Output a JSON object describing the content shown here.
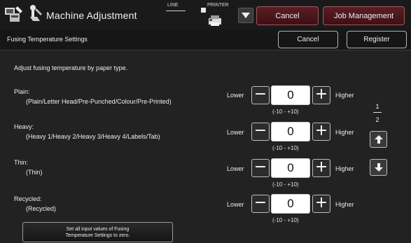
{
  "header": {
    "title": "Machine Adjustment",
    "line_label": "LINE",
    "printer_label": "PRINTER",
    "cancel_label": "Cancel",
    "job_management_label": "Job Management"
  },
  "subheader": {
    "title": "Fusing Temperature Settings",
    "cancel_label": "Cancel",
    "register_label": "Register"
  },
  "instruction": "Adjust fusing temperature by paper type.",
  "settings": [
    {
      "label": "Plain:",
      "description": "(Plain/Letter Head/Pre-Punched/Colour/Pre-Printed)",
      "value": "0",
      "lower_label": "Lower",
      "higher_label": "Higher",
      "range": "(-10 - +10)"
    },
    {
      "label": "Heavy:",
      "description": "(Heavy 1/Heavy 2/Heavy 3/Heavy 4/Labels/Tab)",
      "value": "0",
      "lower_label": "Lower",
      "higher_label": "Higher",
      "range": "(-10 - +10)"
    },
    {
      "label": "Thin:",
      "description": "(Thin)",
      "value": "0",
      "lower_label": "Lower",
      "higher_label": "Higher",
      "range": "(-10 - +10)"
    },
    {
      "label": "Recycled:",
      "description": "(Recycled)",
      "value": "0",
      "lower_label": "Lower",
      "higher_label": "Higher",
      "range": "(-10 - +10)"
    }
  ],
  "pagination": {
    "current": "1",
    "total": "2"
  },
  "reset_button": {
    "line1": "Set all input values of Fusing",
    "line2": "Temperature Settings to zero."
  },
  "icons": {
    "app": "machine-settings-icon",
    "wrench": "wrench-icon",
    "printer": "printer-icon",
    "dropdown": "dropdown-arrow-icon",
    "page_up": "arrow-up-icon",
    "page_down": "arrow-down-icon"
  },
  "colors": {
    "background": "#222222",
    "red_button": "#4a161b",
    "value_box": "#ffffff"
  }
}
